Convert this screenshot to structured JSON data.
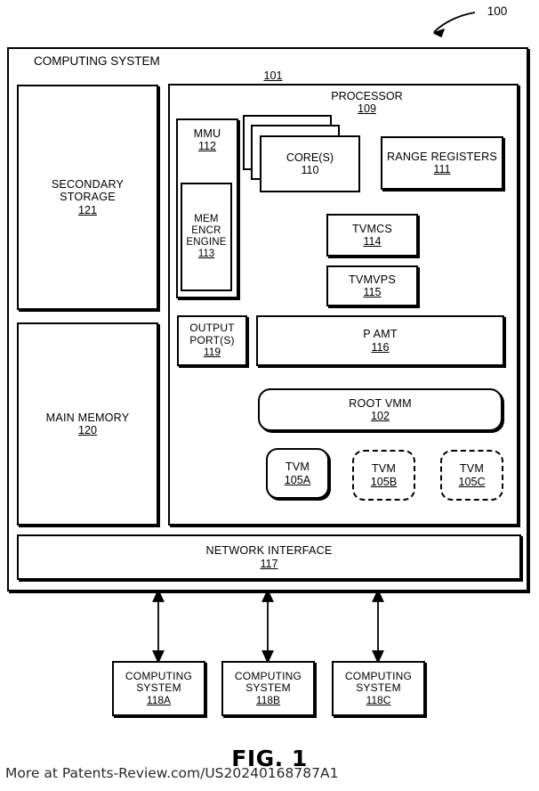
{
  "figure": {
    "caption": "FIG. 1",
    "callout_number": "100",
    "watermark": "More at Patents-Review.com/US20240168787A1"
  },
  "computing_system": {
    "title": "COMPUTING SYSTEM",
    "inner_ref": "101"
  },
  "secondary_storage": {
    "title_line1": "SECONDARY",
    "title_line2": "STORAGE",
    "num": "121"
  },
  "main_memory": {
    "title": "MAIN MEMORY",
    "num": "120"
  },
  "network_interface": {
    "title": "NETWORK INTERFACE",
    "num": "117"
  },
  "processor": {
    "title": "PROCESSOR",
    "num": "109",
    "mmu": {
      "title": "MMU",
      "num": "112"
    },
    "mem_encr_engine": {
      "line1": "MEM",
      "line2": "ENCR",
      "line3": "ENGINE",
      "num": "113"
    },
    "cores": {
      "title": "CORE(S)",
      "num": "110"
    },
    "range_registers": {
      "title": "RANGE REGISTERS",
      "num": "111"
    },
    "tvmcs": {
      "title": "TVMCS",
      "num": "114"
    },
    "tvmvps": {
      "title": "TVMVPS",
      "num": "115"
    },
    "output_ports": {
      "line1": "OUTPUT",
      "line2": "PORT(S)",
      "num": "119"
    },
    "pamt": {
      "title": "P AMT",
      "num": "116"
    },
    "root_vmm": {
      "title": "ROOT VMM",
      "num": "102"
    },
    "tvms": [
      {
        "title": "TVM",
        "num": "105A",
        "style": "solid"
      },
      {
        "title": "TVM",
        "num": "105B",
        "style": "dashed"
      },
      {
        "title": "TVM",
        "num": "105C",
        "style": "dashed"
      }
    ]
  },
  "external_systems": [
    {
      "line1": "COMPUTING",
      "line2": "SYSTEM",
      "num": "118A"
    },
    {
      "line1": "COMPUTING",
      "line2": "SYSTEM",
      "num": "118B"
    },
    {
      "line1": "COMPUTING",
      "line2": "SYSTEM",
      "num": "118C"
    }
  ],
  "colors": {
    "line": "#000000",
    "background": "#ffffff"
  }
}
